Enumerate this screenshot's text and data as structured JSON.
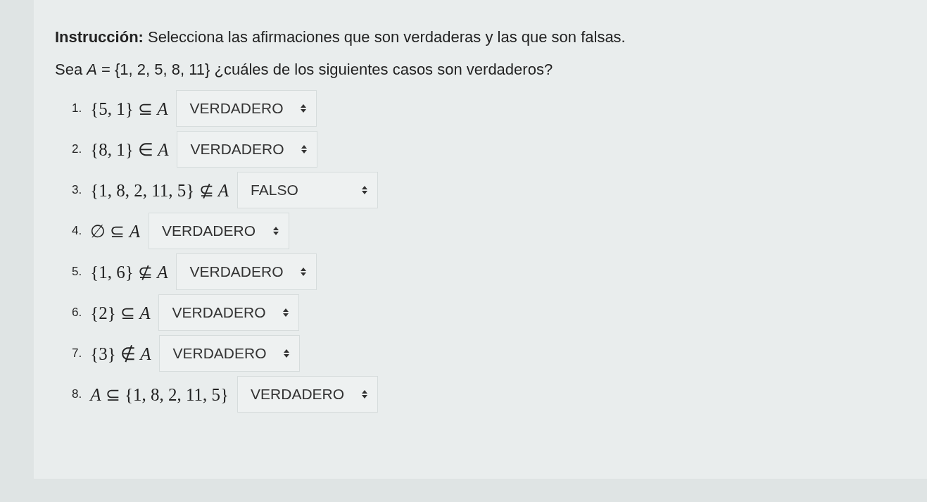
{
  "instruction": "**Instrucción:** Selecciona las afirmaciones que son verdaderas y las que son falsas.",
  "question": "Sea *A* = {1, 2, 5, 8, 11} ¿cuáles de los siguientes casos  son verdaderos?",
  "items": [
    {
      "number": "1.",
      "statement": "{5, 1} ⊆ *A*",
      "answer": "VERDADERO"
    },
    {
      "number": "2.",
      "statement": "{8, 1} ∈ *A*",
      "answer": "VERDADERO"
    },
    {
      "number": "3.",
      "statement": "{1, 8, 2, 11, 5} ⊈ *A*",
      "answer": "FALSO"
    },
    {
      "number": "4.",
      "statement": "∅ ⊆ *A*",
      "answer": "VERDADERO"
    },
    {
      "number": "5.",
      "statement": "{1, 6} ⊈ *A*",
      "answer": "VERDADERO"
    },
    {
      "number": "6.",
      "statement": "{2} ⊆ *A*",
      "answer": "VERDADERO"
    },
    {
      "number": "7.",
      "statement": "{3} ∉ *A*",
      "answer": "VERDADERO"
    },
    {
      "number": "8.",
      "statement": "*A* ⊆ {1, 8, 2, 11, 5}",
      "answer": "VERDADERO"
    }
  ]
}
